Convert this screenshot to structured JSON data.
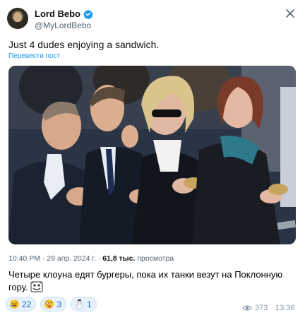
{
  "tweet": {
    "author_name": "Lord Bebo",
    "handle": "@MyLordBebo",
    "text": "Just 4 dudes enjoying a sandwich.",
    "translate_label": "Перевести пост",
    "time": "10:40 PM",
    "separator": "·",
    "date": "29 апр. 2024 г.",
    "views_count": "61,8 тыс.",
    "views_label": "просмотра"
  },
  "message": {
    "text": "Четыре клоуна едят бургеры, пока их танки везут на Поклонную гору."
  },
  "reactions": [
    {
      "emoji": "rofl-face-icon",
      "count": "22"
    },
    {
      "emoji": "zany-face-icon",
      "count": "3"
    },
    {
      "emoji": "snowman-icon",
      "count": "1"
    }
  ],
  "footer": {
    "views": "373",
    "time": "13:36"
  },
  "colors": {
    "link": "#1d9bf0",
    "verified": "#1d9bf0",
    "reaction_bg": "#e6f1fb",
    "muted": "#536471"
  }
}
